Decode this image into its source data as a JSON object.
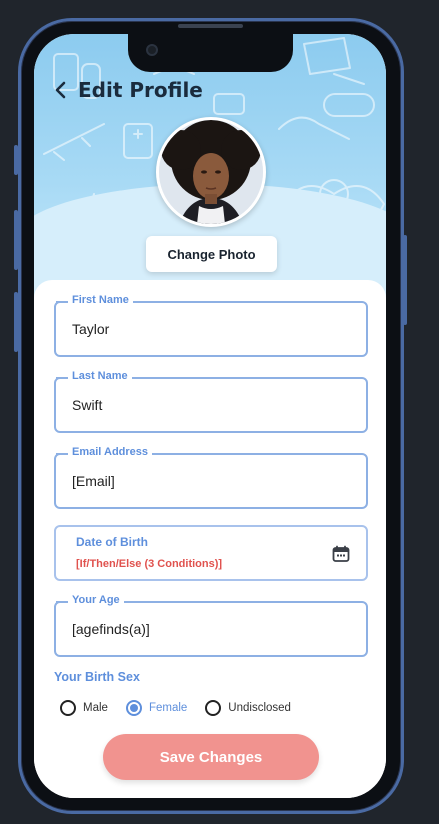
{
  "header": {
    "title": "Edit Profile",
    "change_photo_label": "Change Photo"
  },
  "form": {
    "first_name": {
      "label": "First Name",
      "value": "Taylor"
    },
    "last_name": {
      "label": "Last Name",
      "value": "Swift"
    },
    "email": {
      "label": "Email Address",
      "value": "[Email]"
    },
    "dob": {
      "label": "Date of Birth",
      "value": "[If/Then/Else (3 Conditions)]"
    },
    "age": {
      "label": "Your Age",
      "value": "[agefinds(a)]"
    },
    "sex": {
      "title": "Your Birth Sex",
      "options": [
        "Male",
        "Female",
        "Undisclosed"
      ],
      "selected": "Female"
    }
  },
  "actions": {
    "save_label": "Save Changes"
  },
  "colors": {
    "accent": "#5e8fdc",
    "field_border": "#8db0e4",
    "save_button": "#f1938f",
    "dob_value": "#e0524e",
    "header_bg": "#8ccbef"
  },
  "icons": [
    "back-chevron-icon",
    "calendar-icon"
  ]
}
